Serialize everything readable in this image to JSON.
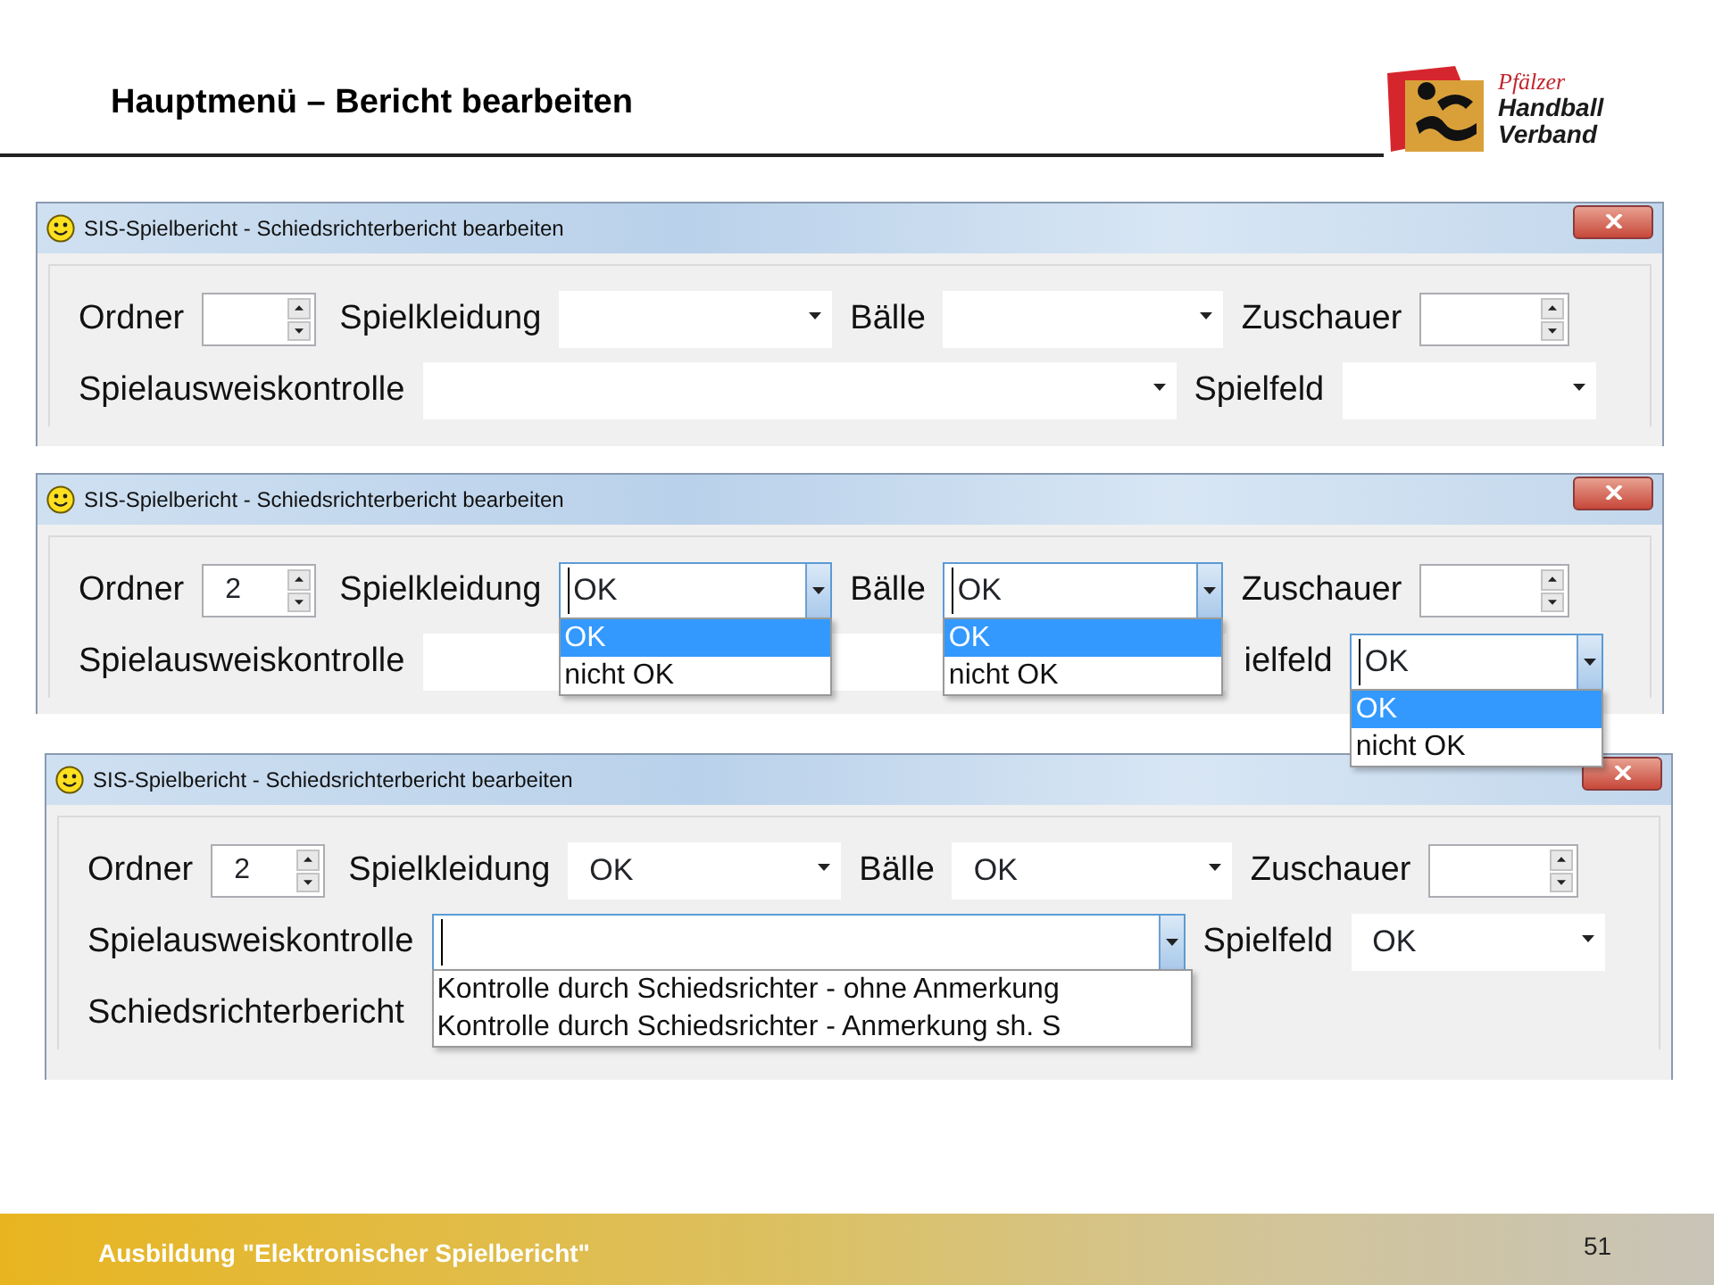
{
  "slide": {
    "title": "Hauptmenü – Bericht bearbeiten",
    "logo": {
      "lines": [
        "Pfälzer",
        "Handball",
        "Verband"
      ]
    },
    "footer": "Ausbildung \"Elektronischer Spielbericht\"",
    "page_number": "51"
  },
  "windows": [
    {
      "title": "SIS-Spielbericht - Schiedsrichterbericht bearbeiten",
      "rows": [
        {
          "fields": [
            {
              "kind": "spin",
              "label": "Ordner"
            },
            {
              "kind": "combo",
              "label": "Spielkleidung",
              "open": false
            },
            {
              "kind": "combo",
              "label": "Bälle",
              "open": false
            },
            {
              "kind": "spin",
              "label": "Zuschauer"
            }
          ]
        },
        {
          "fields": [
            {
              "kind": "combo",
              "label": "Spielausweiskontrolle",
              "open": false
            },
            {
              "kind": "combo",
              "label": "Spielfeld",
              "open": false
            }
          ]
        }
      ]
    },
    {
      "title": "SIS-Spielbericht - Schiedsrichterbericht bearbeiten",
      "rows": [
        {
          "fields": [
            {
              "kind": "spin",
              "label": "Ordner",
              "value": "2"
            },
            {
              "kind": "combo",
              "label": "Spielkleidung",
              "value": "OK",
              "open": true,
              "options": [
                {
                  "label": "OK",
                  "selected": true
                },
                {
                  "label": "nicht OK",
                  "selected": false
                }
              ]
            },
            {
              "kind": "combo",
              "label": "Bälle",
              "value": "OK",
              "open": true,
              "options": [
                {
                  "label": "OK",
                  "selected": true
                },
                {
                  "label": "nicht OK",
                  "selected": false
                }
              ]
            },
            {
              "kind": "spin",
              "label": "Zuschauer"
            }
          ]
        },
        {
          "fields": [
            {
              "kind": "combo",
              "label": "Spielausweiskontrolle",
              "open": false
            },
            {
              "kind": "combo",
              "label": "ielfeld",
              "value": "OK",
              "open": true,
              "options": [
                {
                  "label": "OK",
                  "selected": true
                },
                {
                  "label": "nicht OK",
                  "selected": false
                }
              ]
            }
          ]
        }
      ]
    },
    {
      "title": "SIS-Spielbericht - Schiedsrichterbericht bearbeiten",
      "rows": [
        {
          "fields": [
            {
              "kind": "spin",
              "label": "Ordner",
              "value": "2"
            },
            {
              "kind": "combo",
              "label": "Spielkleidung",
              "value": "OK",
              "open": false
            },
            {
              "kind": "combo",
              "label": "Bälle",
              "value": "OK",
              "open": false
            },
            {
              "kind": "spin",
              "label": "Zuschauer"
            }
          ]
        },
        {
          "fields": [
            {
              "kind": "combo",
              "label": "Spielausweiskontrolle",
              "open": true,
              "options": [
                {
                  "label": "Kontrolle durch Schiedsrichter - ohne Anmerkung",
                  "selected": false
                },
                {
                  "label": "Kontrolle durch Schiedsrichter - Anmerkung sh. S",
                  "selected": false
                }
              ]
            },
            {
              "kind": "combo",
              "label": "Spielfeld",
              "value": "OK",
              "open": false
            }
          ]
        },
        {
          "fields": [
            {
              "kind": "label",
              "label": "Schiedsrichterbericht"
            }
          ]
        }
      ]
    }
  ]
}
